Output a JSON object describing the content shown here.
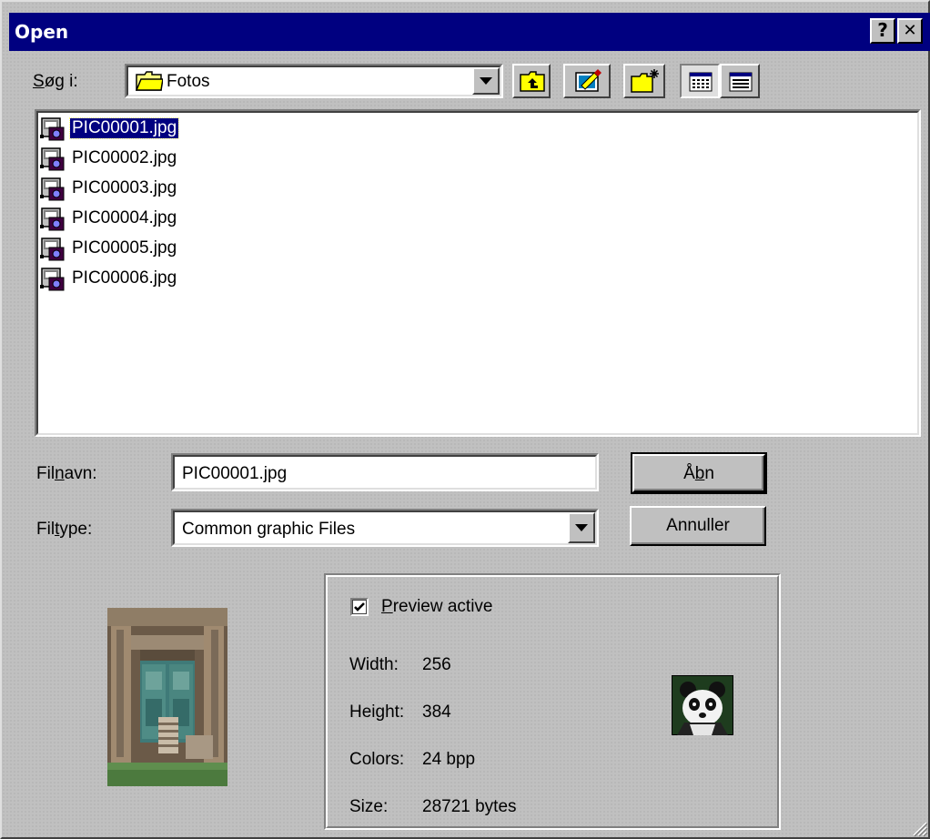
{
  "window": {
    "title": "Open",
    "help_button": "?",
    "close_button": "✕"
  },
  "toolbar": {
    "look_in_label": "Søg i:",
    "look_in_mnemonic": "S",
    "look_in_rest": "øg i:",
    "folder_value": "Fotos",
    "icons": [
      "up-folder-icon",
      "desktop-icon",
      "new-folder-icon",
      "list-view-icon",
      "details-view-icon"
    ]
  },
  "files": [
    {
      "name": "PIC00001.jpg",
      "selected": true
    },
    {
      "name": "PIC00002.jpg",
      "selected": false
    },
    {
      "name": "PIC00003.jpg",
      "selected": false
    },
    {
      "name": "PIC00004.jpg",
      "selected": false
    },
    {
      "name": "PIC00005.jpg",
      "selected": false
    },
    {
      "name": "PIC00006.jpg",
      "selected": false
    }
  ],
  "form": {
    "filename_label_pre": "Fil",
    "filename_label_mnemonic": "n",
    "filename_label_post": "avn:",
    "filename_value": "PIC00001.jpg",
    "filetype_label_pre": "Fil",
    "filetype_label_mnemonic": "t",
    "filetype_label_post": "ype:",
    "filetype_value": "Common graphic Files"
  },
  "buttons": {
    "open_pre": "Å",
    "open_mnemonic": "b",
    "open_post": "n",
    "cancel": "Annuller"
  },
  "preview": {
    "active_mnemonic": "P",
    "active_rest": "review active",
    "checked": true,
    "width_label": "Width:",
    "width_value": "256",
    "height_label": "Height:",
    "height_value": "384",
    "colors_label": "Colors:",
    "colors_value": "24 bpp",
    "size_label": "Size:",
    "size_value": "28721 bytes"
  },
  "colors": {
    "titlebar": "#000080",
    "face": "#c0c0c0",
    "selection": "#000080"
  }
}
